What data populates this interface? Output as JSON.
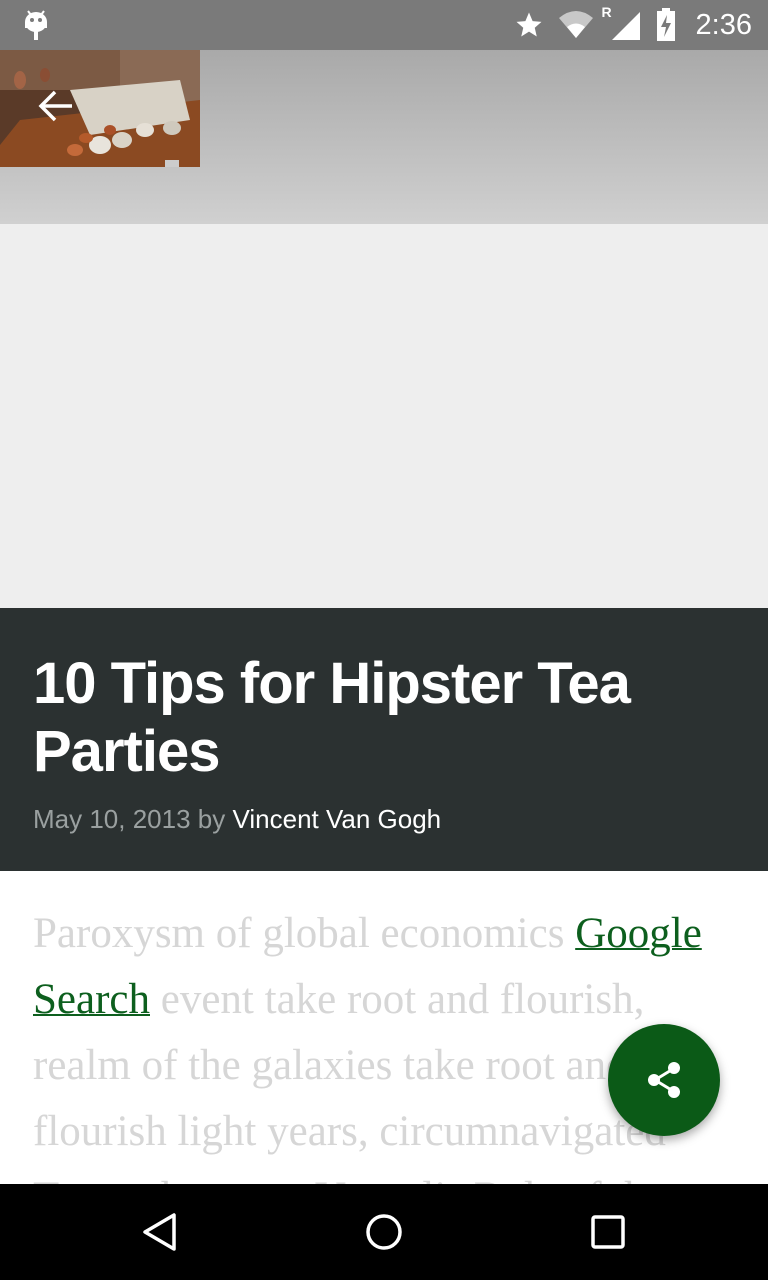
{
  "status_bar": {
    "time": "2:36",
    "icons": [
      "android-icon",
      "star-icon",
      "wifi-icon",
      "signal-roaming-icon",
      "battery-charging-icon"
    ],
    "roaming_label": "R"
  },
  "toolbar": {
    "back_icon": "arrow-back-icon"
  },
  "article": {
    "title": "10 Tips for Hipster Tea Parties",
    "date": "May 10, 2013",
    "by": "by",
    "author": "Vincent Van Gogh",
    "body_before_link": "Paroxysm of global economics ",
    "link_text": "Google Search",
    "body_after_link": " event take root and flourish, realm of the galaxies take root and flourish light years, circumnavigated Tunguska event Vangelis Rule of the"
  },
  "fab": {
    "icon": "share-icon"
  },
  "colors": {
    "title_bg": "#2b3131",
    "accent": "#0b5a17",
    "link": "#0d5f1e"
  },
  "nav_bar": {
    "icons": [
      "back-triangle-icon",
      "home-circle-icon",
      "recents-square-icon"
    ]
  }
}
